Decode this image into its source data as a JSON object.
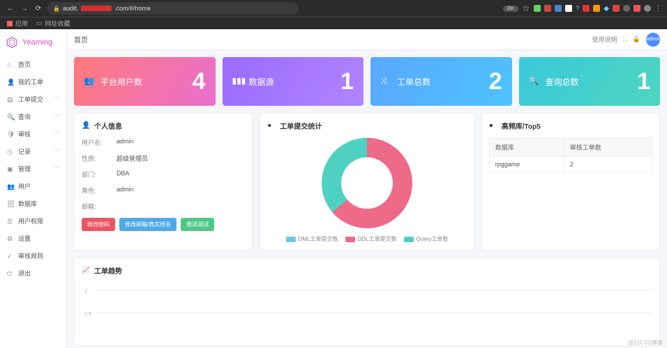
{
  "browser": {
    "url_prefix": "audit.",
    "url_suffix": ".com/#/home",
    "on_badge": "On",
    "bookmarks": {
      "apps": "应用",
      "fav": "网址收藏"
    }
  },
  "brand": "Yearning",
  "nav": [
    {
      "label": "首页",
      "expandable": false
    },
    {
      "label": "我的工单",
      "expandable": false
    },
    {
      "label": "工单提交",
      "expandable": true
    },
    {
      "label": "查询",
      "expandable": true
    },
    {
      "label": "审核",
      "expandable": true
    },
    {
      "label": "记录",
      "expandable": true
    },
    {
      "label": "管理",
      "expandable": true
    },
    {
      "label": "用户",
      "expandable": false
    },
    {
      "label": "数据库",
      "expandable": false
    },
    {
      "label": "用户权限",
      "expandable": false
    },
    {
      "label": "设置",
      "expandable": false
    },
    {
      "label": "审核规则",
      "expandable": false
    },
    {
      "label": "退出",
      "expandable": false
    }
  ],
  "topbar": {
    "crumb": "首页",
    "guide": "使用说明",
    "avatar": "admin"
  },
  "stats": [
    {
      "label": "平台用户数",
      "value": "4"
    },
    {
      "label": "数据源",
      "value": "1"
    },
    {
      "label": "工单总数",
      "value": "2"
    },
    {
      "label": "查询总数",
      "value": "1"
    }
  ],
  "profile": {
    "title": "个人信息",
    "rows": [
      {
        "k": "用户名:",
        "v": "admin"
      },
      {
        "k": "性质:",
        "v": "超级管理员"
      },
      {
        "k": "部门:",
        "v": "DBA"
      },
      {
        "k": "角色:",
        "v": "admin"
      },
      {
        "k": "邮箱:",
        "v": ""
      }
    ],
    "buttons": {
      "red": "修改密码",
      "blue": "修改邮箱/真实姓名",
      "green": "推送测试"
    }
  },
  "submit_stats": {
    "title": "工单提交统计",
    "legend": [
      "DML工单提交数",
      "DDL工单提交数",
      "Query工单数"
    ]
  },
  "top5": {
    "title": "高频库/Top5",
    "headers": [
      "数据库",
      "审核工单数"
    ],
    "rows": [
      [
        "rpggame",
        "2"
      ]
    ]
  },
  "trend": {
    "title": "工单趋势"
  },
  "chart_data": {
    "donut": {
      "type": "pie",
      "title": "工单提交统计",
      "series": [
        {
          "name": "DML工单提交数",
          "value": 0,
          "color": "#6fc6e8"
        },
        {
          "name": "DDL工单提交数",
          "value": 64,
          "color": "#ed6a89"
        },
        {
          "name": "Query工单数",
          "value": 36,
          "color": "#4fd1c1"
        }
      ]
    },
    "trend": {
      "type": "line",
      "title": "工单趋势",
      "y_ticks": [
        1.5,
        2
      ],
      "ylim": [
        1.5,
        2
      ],
      "series": []
    }
  },
  "watermark": "@51CTO博客"
}
